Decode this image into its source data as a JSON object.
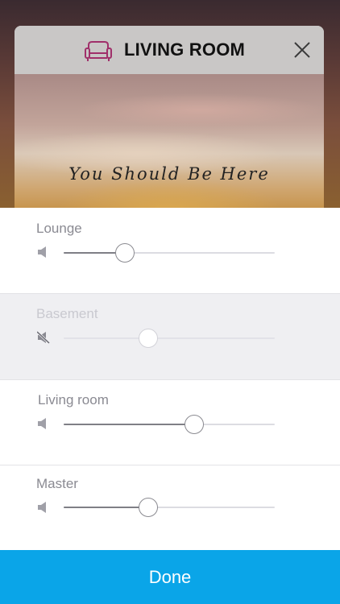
{
  "header": {
    "title": "LIVING ROOM",
    "room_icon": "sofa-icon",
    "close_icon": "close-icon"
  },
  "artwork": {
    "caption": "You Should Be Here"
  },
  "zones": [
    {
      "name": "Lounge",
      "volume": 0.29,
      "muted": false,
      "enabled": true
    },
    {
      "name": "Basement",
      "volume": 0.4,
      "muted": true,
      "enabled": false
    },
    {
      "name": "Living room",
      "volume": 0.62,
      "muted": false,
      "enabled": true
    },
    {
      "name": "Master",
      "volume": 0.4,
      "muted": false,
      "enabled": true
    }
  ],
  "done_label": "Done",
  "colors": {
    "accent": "#0aa5e8",
    "room_icon": "#a0306a"
  }
}
